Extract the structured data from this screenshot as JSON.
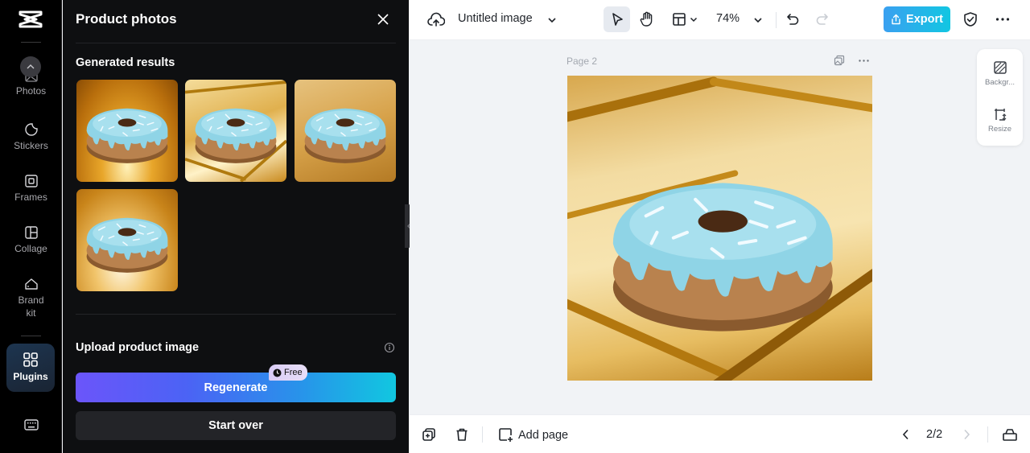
{
  "rail": {
    "items": [
      {
        "label": "Photos",
        "icon": "photo-icon"
      },
      {
        "label": "Stickers",
        "icon": "sticker-icon"
      },
      {
        "label": "Frames",
        "icon": "frame-icon"
      },
      {
        "label": "Collage",
        "icon": "collage-icon"
      },
      {
        "label": "Brand kit",
        "icon": "brand-kit-icon"
      },
      {
        "label": "Plugins",
        "icon": "plugins-icon",
        "active": true
      }
    ]
  },
  "panel": {
    "title": "Product photos",
    "generated_label": "Generated results",
    "results": [
      {
        "alt": "Blue glazed donut on amber background"
      },
      {
        "alt": "Blue glazed donut with gold frame"
      },
      {
        "alt": "Blue glazed donut on golden surface"
      },
      {
        "alt": "Blue glazed donut with soft glow"
      }
    ],
    "upload_label": "Upload product image",
    "regenerate_label": "Regenerate",
    "free_badge": "Free",
    "start_over_label": "Start over"
  },
  "topbar": {
    "doc_title": "Untitled image",
    "zoom": "74%",
    "export_label": "Export"
  },
  "canvas": {
    "page_label": "Page 2",
    "side_tools": [
      {
        "label": "Backgr...",
        "icon": "background-icon"
      },
      {
        "label": "Resize",
        "icon": "resize-icon"
      }
    ]
  },
  "bottombar": {
    "add_page_label": "Add page",
    "pager": "2/2"
  },
  "colors": {
    "accent_gradient_start": "#6b55fa",
    "accent_gradient_end": "#11c7e0",
    "export_start": "#3aa0f0",
    "export_end": "#12c6e2"
  }
}
